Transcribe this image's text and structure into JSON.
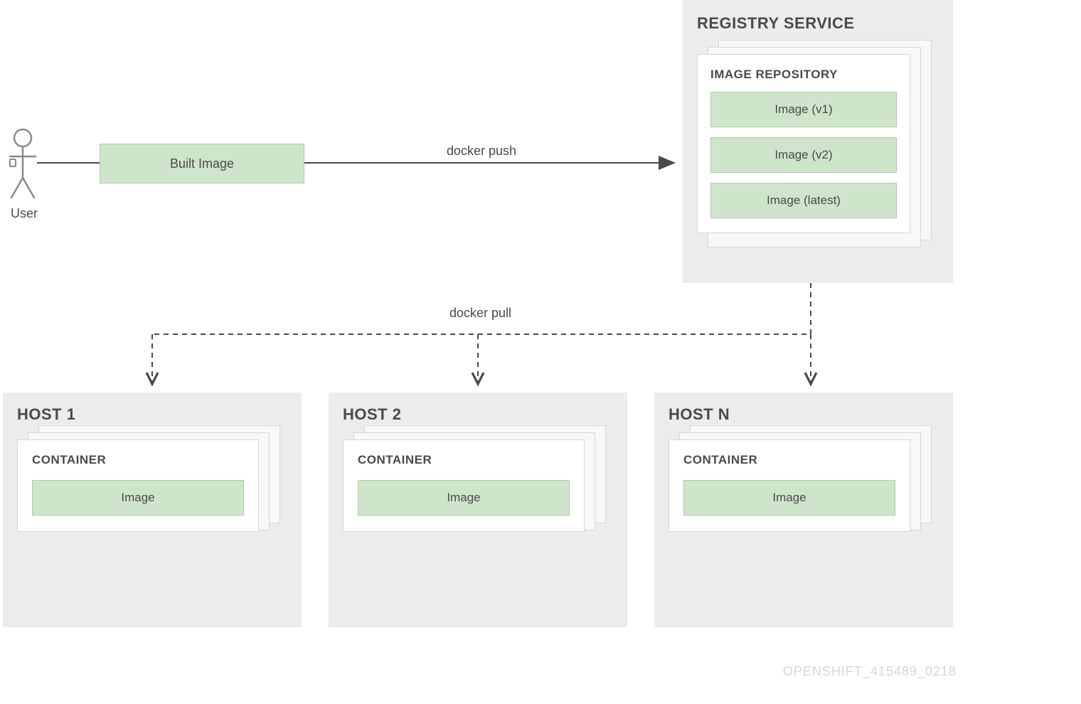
{
  "user": {
    "label": "User"
  },
  "builtImage": {
    "label": "Built Image"
  },
  "pushLabel": "docker push",
  "pullLabel": "docker pull",
  "registry": {
    "title": "REGISTRY SERVICE",
    "repository": {
      "title": "IMAGE REPOSITORY",
      "images": [
        "Image (v1)",
        "Image (v2)",
        "Image (latest)"
      ]
    }
  },
  "hosts": [
    {
      "title": "HOST 1",
      "container": {
        "title": "CONTAINER",
        "image": "Image"
      }
    },
    {
      "title": "HOST 2",
      "container": {
        "title": "CONTAINER",
        "image": "Image"
      }
    },
    {
      "title": "HOST N",
      "container": {
        "title": "CONTAINER",
        "image": "Image"
      }
    }
  ],
  "watermark": "OPENSHIFT_415489_0218"
}
